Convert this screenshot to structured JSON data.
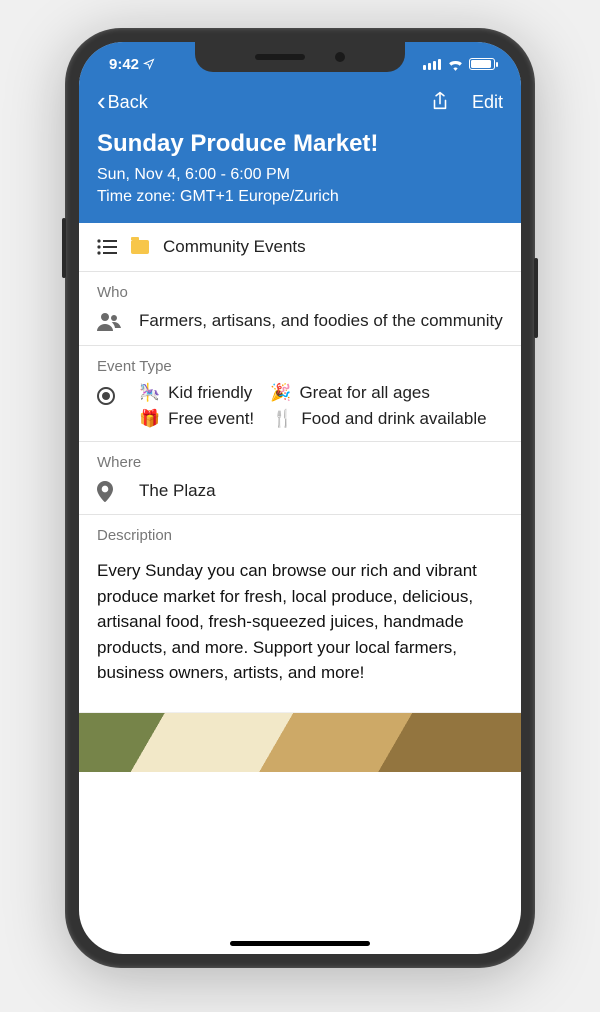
{
  "status": {
    "time": "9:42"
  },
  "nav": {
    "back_label": "Back",
    "edit_label": "Edit"
  },
  "event": {
    "title": "Sunday Produce Market!",
    "date_line": "Sun, Nov 4, 6:00 - 6:00 PM",
    "tz_line": "Time zone: GMT+1 Europe/Zurich"
  },
  "category": {
    "name": "Community Events"
  },
  "who": {
    "label": "Who",
    "value": "Farmers, artisans, and foodies of the community"
  },
  "event_type": {
    "label": "Event Type",
    "tags": [
      {
        "emoji": "🎠",
        "text": "Kid friendly"
      },
      {
        "emoji": "🎉",
        "text": "Great for all ages"
      },
      {
        "emoji": "🎁",
        "text": "Free event!"
      },
      {
        "emoji": "🍴",
        "text": "Food and drink available"
      }
    ]
  },
  "where": {
    "label": "Where",
    "value": "The Plaza"
  },
  "description": {
    "label": "Description",
    "text": "Every Sunday you can browse our rich and vibrant produce market for fresh, local produce, delicious, artisanal food, fresh-squeezed juices, handmade products, and more. Support your local farmers, business owners, artists, and more!"
  }
}
